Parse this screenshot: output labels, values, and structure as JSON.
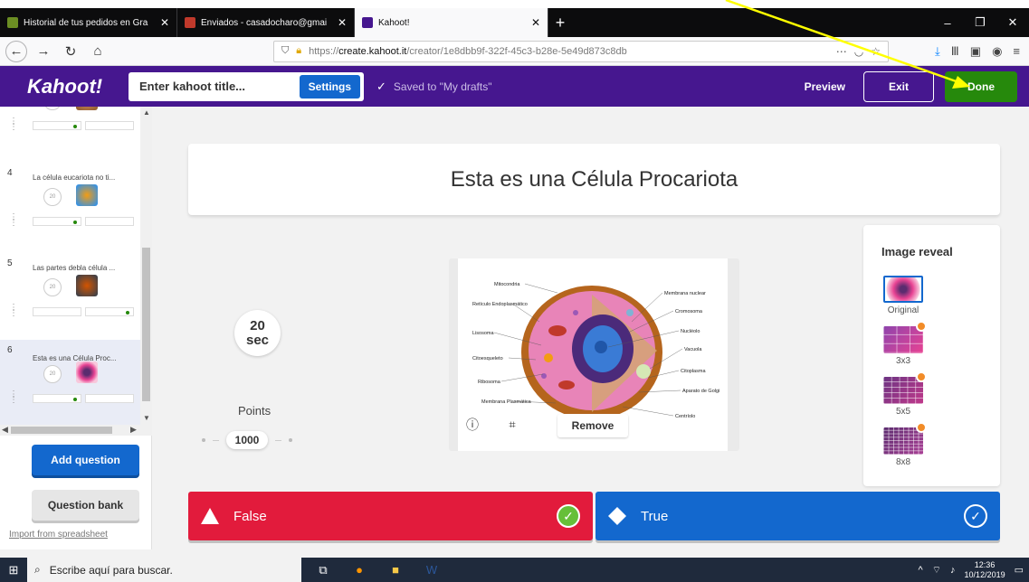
{
  "browser": {
    "tabs": [
      {
        "label": "Historial de tus pedidos en Gra",
        "favicon_color": "#6b8e23",
        "active": false
      },
      {
        "label": "Enviados - casadocharo@gmai",
        "favicon_color": "#c0392b",
        "active": false
      },
      {
        "label": "Kahoot!",
        "favicon_color": "#46178f",
        "active": true
      }
    ],
    "url": "https://create.kahoot.it/creator/1e8dbb9f-322f-45c3-b28e-5e49d873c8db",
    "url_host": "create.kahoot.it",
    "url_prefix": "https://",
    "url_suffix": "/creator/1e8dbb9f-322f-45c3-b28e-5e49d873c8db"
  },
  "header": {
    "logo": "Kahoot!",
    "title_placeholder": "Enter kahoot title...",
    "settings": "Settings",
    "saved": "Saved to \"My drafts\"",
    "preview": "Preview",
    "exit": "Exit",
    "done": "Done"
  },
  "sidebar": {
    "slides": [
      {
        "number": "",
        "title": "",
        "timer": "20",
        "img_color": "#b5651d"
      },
      {
        "number": "4",
        "title": "La célula eucariota no ti...",
        "timer": "20",
        "img_color": "#e67e22"
      },
      {
        "number": "5",
        "title": "Las partes debla célula ...",
        "timer": "20",
        "img_color": "#8e6b3a"
      },
      {
        "number": "6",
        "title": "Esta es una Célula Proc...",
        "timer": "20",
        "img_color": "#c0398b"
      }
    ],
    "add_question": "Add question",
    "question_bank": "Question bank",
    "import": "Import from spreadsheet"
  },
  "question": {
    "text": "Esta es una Célula Procariota",
    "timer_value": "20",
    "timer_unit": "sec",
    "points_label": "Points",
    "points_value": "1000"
  },
  "media": {
    "remove": "Remove",
    "labels": [
      "Mitocondria",
      "Retículo Endoplasmático",
      "Lisosoma",
      "Citoesqueleto",
      "Ribosoma",
      "Membrana Plasmática",
      "Membrana nuclear",
      "Cromosoma",
      "Nucléolo",
      "Vacuola",
      "Citoplasma",
      "Aparato de Golgi",
      "Centríolo"
    ]
  },
  "image_reveal": {
    "title": "Image reveal",
    "options": [
      {
        "label": "Original",
        "selected": true
      },
      {
        "label": "3x3",
        "selected": false
      },
      {
        "label": "5x5",
        "selected": false
      },
      {
        "label": "8x8",
        "selected": false
      }
    ]
  },
  "answers": [
    {
      "text": "False",
      "correct": true,
      "color": "#e21b3c"
    },
    {
      "text": "True",
      "correct": false,
      "color": "#1368ce"
    }
  ],
  "taskbar": {
    "search_placeholder": "Escribe aquí para buscar.",
    "time": "12:36",
    "date": "10/12/2019"
  }
}
